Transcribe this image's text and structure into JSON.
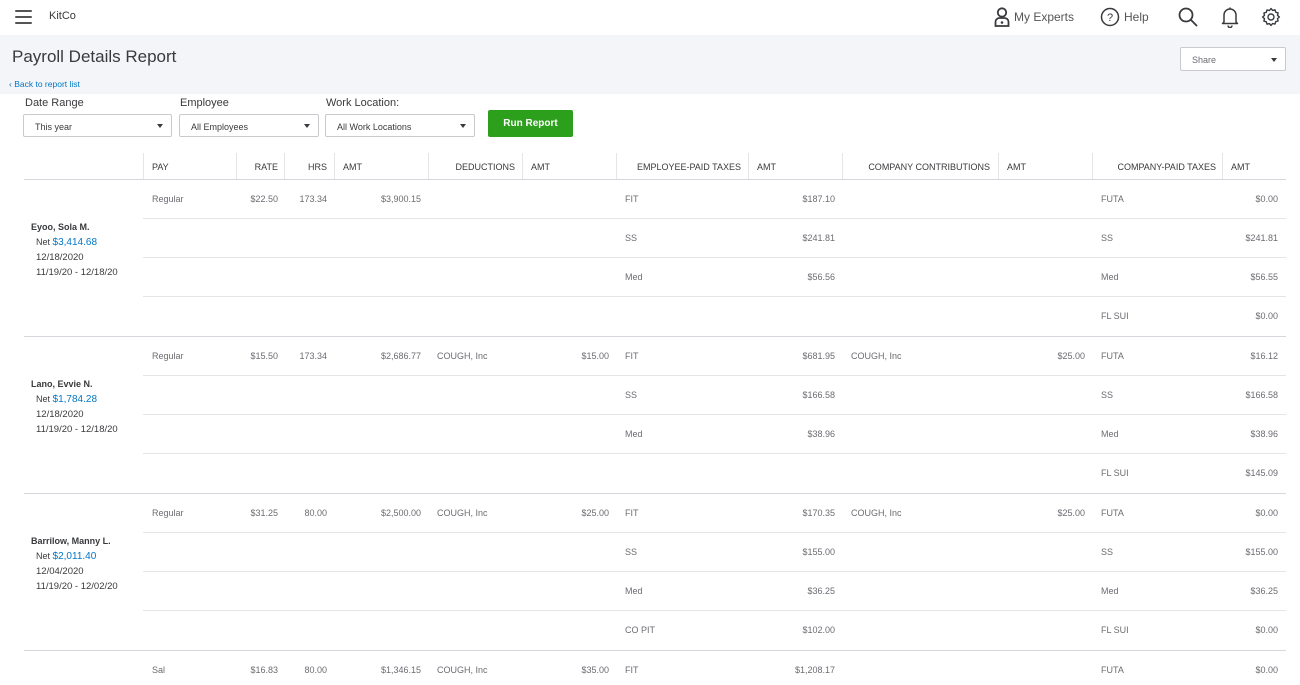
{
  "topbar": {
    "company": "KitCo",
    "my_experts": "My Experts",
    "help": "Help"
  },
  "header": {
    "title": "Payroll Details Report",
    "back_link": "Back to report list",
    "share": "Share"
  },
  "filters": {
    "date_range": {
      "label": "Date Range",
      "value": "This year"
    },
    "employee": {
      "label": "Employee",
      "value": "All Employees"
    },
    "work_location": {
      "label": "Work Location:",
      "value": "All Work Locations"
    },
    "run_button": "Run Report"
  },
  "colors": {
    "accent_green": "#2ca01c",
    "link_blue": "#0077c5",
    "header_bg": "#f4f5f8"
  },
  "table": {
    "headers": {
      "pay": "PAY",
      "rate": "RATE",
      "hrs": "HRS",
      "pay_amt": "AMT",
      "deductions": "DEDUCTIONS",
      "ded_amt": "AMT",
      "emp_taxes": "EMPLOYEE-PAID TAXES",
      "emp_tax_amt": "AMT",
      "contributions": "COMPANY CONTRIBUTIONS",
      "contrib_amt": "AMT",
      "co_taxes": "COMPANY-PAID TAXES",
      "co_tax_amt": "AMT"
    },
    "employees": [
      {
        "name": "Eyoo, Sola M.",
        "net_label": "Net",
        "net": "$3,414.68",
        "pay_date": "12/18/2020",
        "period": "11/19/20 -  12/18/20",
        "rows": [
          {
            "pay": "Regular",
            "rate": "$22.50",
            "hrs": "173.34",
            "pay_amt": "$3,900.15",
            "deduction": "",
            "ded_amt": "",
            "emp_tax": "FIT",
            "emp_tax_amt": "$187.10",
            "contribution": "",
            "contrib_amt": "",
            "co_tax": "FUTA",
            "co_tax_amt": "$0.00"
          },
          {
            "pay": "",
            "rate": "",
            "hrs": "",
            "pay_amt": "",
            "deduction": "",
            "ded_amt": "",
            "emp_tax": "SS",
            "emp_tax_amt": "$241.81",
            "contribution": "",
            "contrib_amt": "",
            "co_tax": "SS",
            "co_tax_amt": "$241.81"
          },
          {
            "pay": "",
            "rate": "",
            "hrs": "",
            "pay_amt": "",
            "deduction": "",
            "ded_amt": "",
            "emp_tax": "Med",
            "emp_tax_amt": "$56.56",
            "contribution": "",
            "contrib_amt": "",
            "co_tax": "Med",
            "co_tax_amt": "$56.55"
          },
          {
            "pay": "",
            "rate": "",
            "hrs": "",
            "pay_amt": "",
            "deduction": "",
            "ded_amt": "",
            "emp_tax": "",
            "emp_tax_amt": "",
            "contribution": "",
            "contrib_amt": "",
            "co_tax": "FL SUI",
            "co_tax_amt": "$0.00"
          }
        ]
      },
      {
        "name": "Lano, Evvie N.",
        "net_label": "Net",
        "net": "$1,784.28",
        "pay_date": "12/18/2020",
        "period": "11/19/20 -  12/18/20",
        "rows": [
          {
            "pay": "Regular",
            "rate": "$15.50",
            "hrs": "173.34",
            "pay_amt": "$2,686.77",
            "deduction": "COUGH, Inc",
            "ded_amt": "$15.00",
            "emp_tax": "FIT",
            "emp_tax_amt": "$681.95",
            "contribution": "COUGH, Inc",
            "contrib_amt": "$25.00",
            "co_tax": "FUTA",
            "co_tax_amt": "$16.12"
          },
          {
            "pay": "",
            "rate": "",
            "hrs": "",
            "pay_amt": "",
            "deduction": "",
            "ded_amt": "",
            "emp_tax": "SS",
            "emp_tax_amt": "$166.58",
            "contribution": "",
            "contrib_amt": "",
            "co_tax": "SS",
            "co_tax_amt": "$166.58"
          },
          {
            "pay": "",
            "rate": "",
            "hrs": "",
            "pay_amt": "",
            "deduction": "",
            "ded_amt": "",
            "emp_tax": "Med",
            "emp_tax_amt": "$38.96",
            "contribution": "",
            "contrib_amt": "",
            "co_tax": "Med",
            "co_tax_amt": "$38.96"
          },
          {
            "pay": "",
            "rate": "",
            "hrs": "",
            "pay_amt": "",
            "deduction": "",
            "ded_amt": "",
            "emp_tax": "",
            "emp_tax_amt": "",
            "contribution": "",
            "contrib_amt": "",
            "co_tax": "FL SUI",
            "co_tax_amt": "$145.09"
          }
        ]
      },
      {
        "name": "Barrilow, Manny L.",
        "net_label": "Net",
        "net": "$2,011.40",
        "pay_date": "12/04/2020",
        "period": "11/19/20 -  12/02/20",
        "rows": [
          {
            "pay": "Regular",
            "rate": "$31.25",
            "hrs": "80.00",
            "pay_amt": "$2,500.00",
            "deduction": "COUGH, Inc",
            "ded_amt": "$25.00",
            "emp_tax": "FIT",
            "emp_tax_amt": "$170.35",
            "contribution": "COUGH, Inc",
            "contrib_amt": "$25.00",
            "co_tax": "FUTA",
            "co_tax_amt": "$0.00"
          },
          {
            "pay": "",
            "rate": "",
            "hrs": "",
            "pay_amt": "",
            "deduction": "",
            "ded_amt": "",
            "emp_tax": "SS",
            "emp_tax_amt": "$155.00",
            "contribution": "",
            "contrib_amt": "",
            "co_tax": "SS",
            "co_tax_amt": "$155.00"
          },
          {
            "pay": "",
            "rate": "",
            "hrs": "",
            "pay_amt": "",
            "deduction": "",
            "ded_amt": "",
            "emp_tax": "Med",
            "emp_tax_amt": "$36.25",
            "contribution": "",
            "contrib_amt": "",
            "co_tax": "Med",
            "co_tax_amt": "$36.25"
          },
          {
            "pay": "",
            "rate": "",
            "hrs": "",
            "pay_amt": "",
            "deduction": "",
            "ded_amt": "",
            "emp_tax": "CO PIT",
            "emp_tax_amt": "$102.00",
            "contribution": "",
            "contrib_amt": "",
            "co_tax": "FL SUI",
            "co_tax_amt": "$0.00"
          }
        ]
      },
      {
        "name": "",
        "net_label": "",
        "net": "",
        "pay_date": "",
        "period": "",
        "rows": [
          {
            "pay": "Sal",
            "rate": "$16.83",
            "hrs": "80.00",
            "pay_amt": "$1,346.15",
            "deduction": "COUGH, Inc",
            "ded_amt": "$35.00",
            "emp_tax": "FIT",
            "emp_tax_amt": "$1,208.17",
            "contribution": "",
            "contrib_amt": "",
            "co_tax": "FUTA",
            "co_tax_amt": "$0.00"
          }
        ]
      }
    ]
  }
}
